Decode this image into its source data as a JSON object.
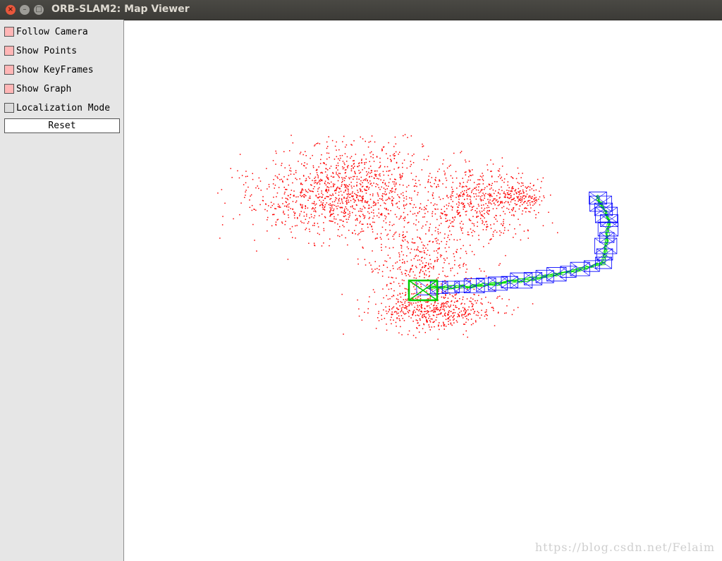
{
  "window": {
    "title": "ORB-SLAM2: Map Viewer",
    "close_glyph": "×",
    "minimize_glyph": "–",
    "maximize_glyph": "□"
  },
  "panel": {
    "options": [
      {
        "label": "Follow Camera",
        "checked": true
      },
      {
        "label": "Show Points",
        "checked": true
      },
      {
        "label": "Show KeyFrames",
        "checked": true
      },
      {
        "label": "Show Graph",
        "checked": true
      },
      {
        "label": "Localization Mode",
        "checked": false
      }
    ],
    "reset_label": "Reset"
  },
  "colors": {
    "map_points": "#ff0000",
    "keyframes": "#0000ff",
    "graph": "#00e000",
    "current_camera": "#00cc00",
    "checked_box": "#ffb6b6"
  },
  "watermark": "https://blog.csdn.net/Felaim"
}
